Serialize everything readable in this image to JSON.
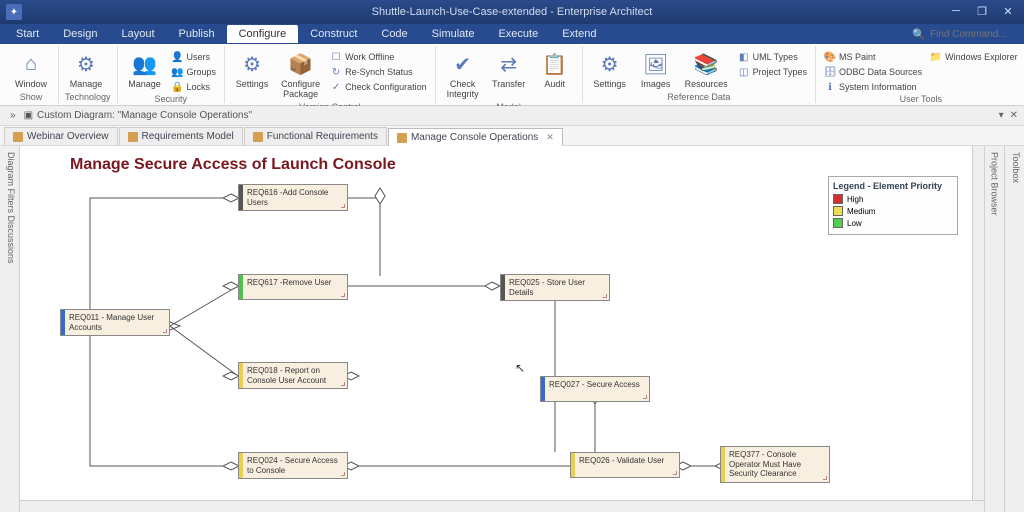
{
  "titlebar": {
    "title": "Shuttle-Launch-Use-Case-extended - Enterprise Architect"
  },
  "menus": [
    "Start",
    "Design",
    "Layout",
    "Publish",
    "Configure",
    "Construct",
    "Code",
    "Simulate",
    "Execute",
    "Extend"
  ],
  "menu_active": 4,
  "find": {
    "placeholder": "Find Command..."
  },
  "ribbon": {
    "show": {
      "window": "Window"
    },
    "technology": {
      "manage": "Manage"
    },
    "security": {
      "manage": "Manage",
      "users": "Users",
      "groups": "Groups",
      "locks": "Locks"
    },
    "version": {
      "settings": "Settings",
      "configpkg": "Configure Package",
      "work_offline": "Work Offline",
      "resynch": "Re-Synch Status",
      "checkcfg": "Check Configuration"
    },
    "model": {
      "check": "Check Integrity",
      "transfer": "Transfer",
      "audit": "Audit"
    },
    "refdata": {
      "settings": "Settings",
      "images": "Images",
      "resources": "Resources",
      "uml": "UML Types",
      "project": "Project Types"
    },
    "usertools": {
      "mspaint": "MS Paint",
      "odbc": "ODBC Data Sources",
      "sysinfo": "System Information",
      "winexp": "Windows Explorer"
    },
    "labels": {
      "show": "Show",
      "technology": "Technology",
      "security": "Security",
      "version": "Version Control",
      "model": "Model",
      "refdata": "Reference Data",
      "usertools": "User Tools"
    }
  },
  "breadcrumb": {
    "text": "Custom Diagram: \"Manage Console Operations\""
  },
  "tabs": [
    {
      "label": "Webinar Overview"
    },
    {
      "label": "Requirements Model"
    },
    {
      "label": "Functional Requirements"
    },
    {
      "label": "Manage Console Operations",
      "active": true
    }
  ],
  "sidepanes": {
    "left": "Diagram Filters  Discussions",
    "right_outer": "Toolbox",
    "right_inner": "Project Browser"
  },
  "diagram": {
    "title": "Manage Secure Access of Launch Console",
    "nodes": {
      "req011": "REQ011 - Manage User Accounts",
      "req616": "REQ616 -Add Console Users",
      "req617": "REQ617 -Remove User",
      "req018": "REQ018 - Report on Console User Account",
      "req024": "REQ024 - Secure Access to Console",
      "req025": "REQ025 - Store User Details",
      "req026": "REQ026 - Validate User",
      "req027": "REQ027 - Secure Access",
      "req377": "REQ377 - Console Operator Must Have Security Clearance"
    },
    "legend": {
      "title": "Legend - Element Priority",
      "high": "High",
      "medium": "Medium",
      "low": "Low"
    }
  }
}
